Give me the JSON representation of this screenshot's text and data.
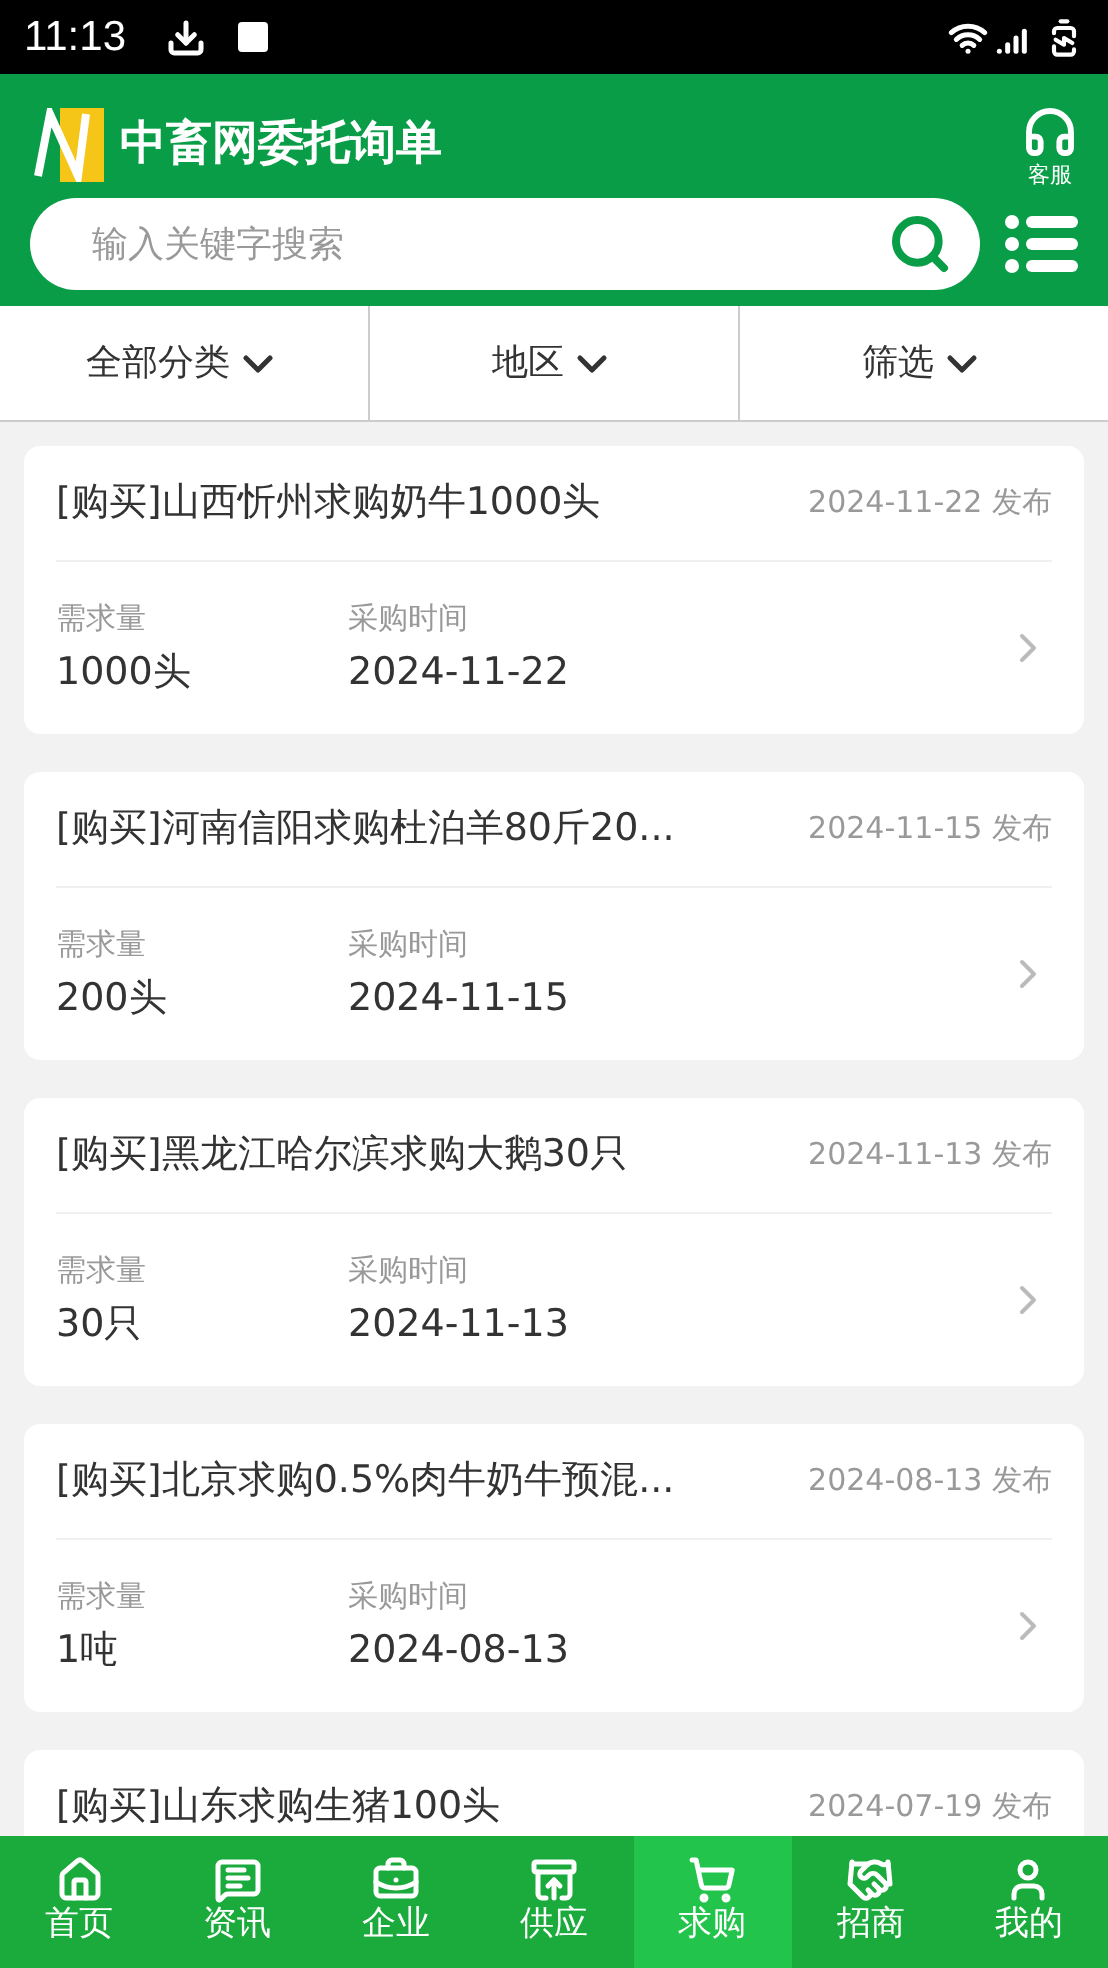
{
  "status_bar": {
    "time": "11:13"
  },
  "header": {
    "title": "中畜网委托询单",
    "service_label": "客服"
  },
  "search": {
    "placeholder": "输入关键字搜索"
  },
  "filters": [
    {
      "label": "全部分类"
    },
    {
      "label": "地区"
    },
    {
      "label": "筛选"
    }
  ],
  "listings": [
    {
      "title": "[购买]山西忻州求购奶牛1000头",
      "date": "2024-11-22 发布",
      "quantity_label": "需求量",
      "quantity": "1000头",
      "time_label": "采购时间",
      "time": "2024-11-22"
    },
    {
      "title": "[购买]河南信阳求购杜泊羊80斤20...",
      "date": "2024-11-15 发布",
      "quantity_label": "需求量",
      "quantity": "200头",
      "time_label": "采购时间",
      "time": "2024-11-15"
    },
    {
      "title": "[购买]黑龙江哈尔滨求购大鹅30只",
      "date": "2024-11-13 发布",
      "quantity_label": "需求量",
      "quantity": "30只",
      "time_label": "采购时间",
      "time": "2024-11-13"
    },
    {
      "title": "[购买]北京求购0.5%肉牛奶牛预混...",
      "date": "2024-08-13 发布",
      "quantity_label": "需求量",
      "quantity": "1吨",
      "time_label": "采购时间",
      "time": "2024-08-13"
    },
    {
      "title": "[购买]山东求购生猪100头",
      "date": "2024-07-19 发布"
    }
  ],
  "bottom_nav": [
    {
      "kind": "home",
      "label": "首页",
      "selected": false
    },
    {
      "kind": "news",
      "label": "资讯",
      "selected": false
    },
    {
      "kind": "company",
      "label": "企业",
      "selected": false
    },
    {
      "kind": "supply",
      "label": "供应",
      "selected": false
    },
    {
      "kind": "buy",
      "label": "求购",
      "selected": true
    },
    {
      "kind": "invest",
      "label": "招商",
      "selected": false
    },
    {
      "kind": "me",
      "label": "我的",
      "selected": false
    }
  ]
}
